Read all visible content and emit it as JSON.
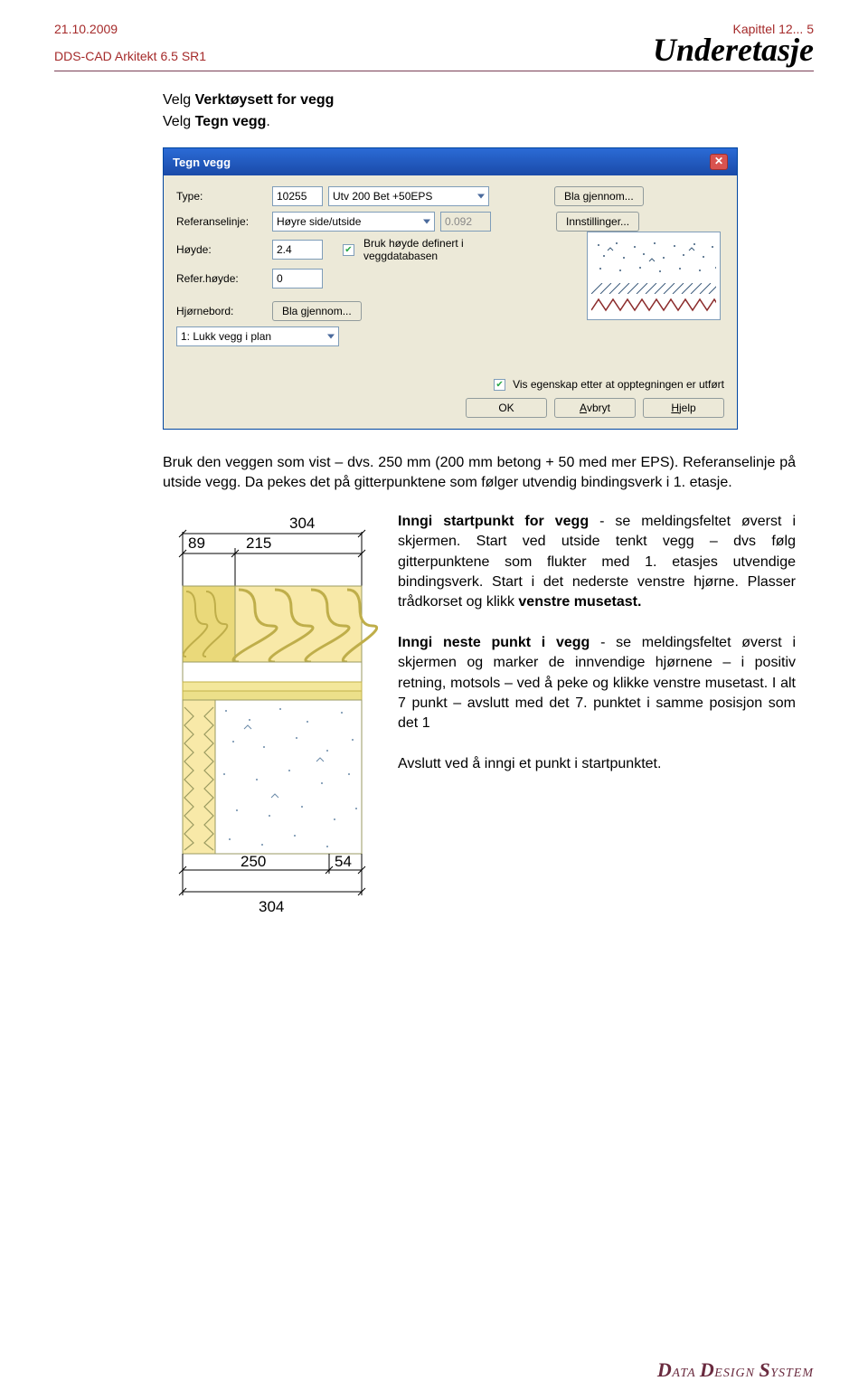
{
  "header": {
    "date": "21.10.2009",
    "chapter": "Kapittel 12... 5",
    "product": "DDS-CAD Arkitekt  6.5 SR1",
    "title": "Underetasje"
  },
  "intro": {
    "line1_a": "Velg ",
    "line1_b": "Verktøysett for vegg",
    "line2_a": "Velg ",
    "line2_b": "Tegn vegg"
  },
  "dialog": {
    "title": "Tegn vegg",
    "labels": {
      "type": "Type:",
      "refline": "Referanselinje:",
      "height": "Høyde:",
      "refheight": "Refer.høyde:",
      "corner": "Hjørnebord:"
    },
    "type_code": "10255",
    "type_name": "Utv 200 Bet +50EPS",
    "browse": "Bla gjennom...",
    "settings": "Innstillinger...",
    "refline_value": "Høyre side/utside",
    "refline_offset": "0.092",
    "height_value": "2.4",
    "db_height_label": "Bruk høyde definert i veggdatabasen",
    "refheight_value": "0",
    "lock_plan": "1: Lukk vegg i plan",
    "show_props": "Vis egenskap etter at opptegningen er utført",
    "ok": "OK",
    "cancel": "Avbryt",
    "help": "Hjelp"
  },
  "para1": "Bruk den veggen som vist – dvs. 250 mm (200 mm betong + 50 med mer EPS). Referanselinje på utside vegg. Da pekes det på gitterpunktene som følger utvendig bindingsverk i 1. etasje.",
  "drawing": {
    "dim_top": "304",
    "dim_left1": "89",
    "dim_left2": "215",
    "dim_bot1": "250",
    "dim_bot2": "54",
    "dim_bot_total": "304"
  },
  "block1": {
    "title": "Inngi startpunkt for vegg",
    "rest": " - se meldingsfeltet øverst i skjermen. Start ved utside tenkt vegg – dvs følg gitterpunktene som flukter med 1. etasjes utvendige bindingsverk. Start i det nederste venstre hjørne. Plasser trådkorset og klikk ",
    "bold_end": "venstre musetast."
  },
  "block2": {
    "title": "Inngi neste punkt i vegg",
    "rest": " - se meldingsfeltet øverst i skjermen og marker de innvendige hjørnene – i positiv retning, motsols – ved å peke og klikke venstre musetast. I alt 7 punkt – avslutt med det 7. punktet i samme posisjon som det 1"
  },
  "block3": "Avslutt ved å inngi  et punkt i startpunktet.",
  "footer": {
    "d1": "D",
    "t1": "ATA ",
    "d2": "D",
    "t2": "ESIGN ",
    "d3": "S",
    "t3": "YSTEM"
  }
}
